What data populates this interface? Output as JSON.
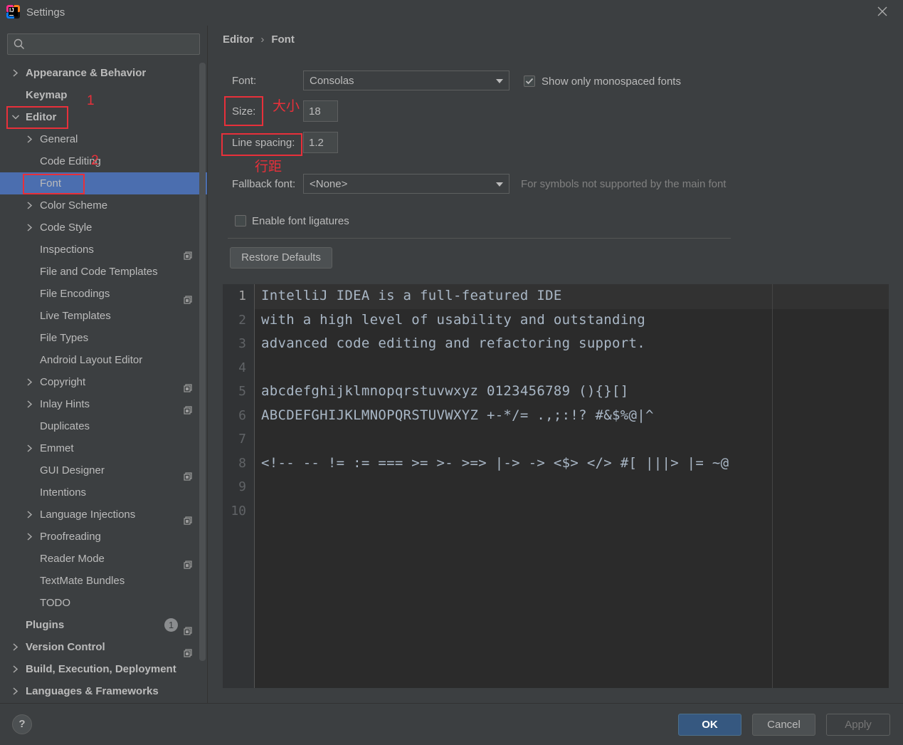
{
  "window": {
    "title": "Settings"
  },
  "search": {
    "placeholder": ""
  },
  "sidebar": {
    "items": [
      {
        "label": "Appearance & Behavior",
        "level": 0,
        "bold": true,
        "expandable": true,
        "expanded": false,
        "project_icon": false
      },
      {
        "label": "Keymap",
        "level": 0,
        "bold": true,
        "expandable": false,
        "project_icon": false
      },
      {
        "label": "Editor",
        "level": 0,
        "bold": true,
        "expandable": true,
        "expanded": true,
        "project_icon": false
      },
      {
        "label": "General",
        "level": 1,
        "expandable": true,
        "expanded": false,
        "project_icon": false
      },
      {
        "label": "Code Editing",
        "level": 1,
        "expandable": false,
        "project_icon": false
      },
      {
        "label": "Font",
        "level": 1,
        "expandable": false,
        "selected": true,
        "project_icon": false
      },
      {
        "label": "Color Scheme",
        "level": 1,
        "expandable": true,
        "expanded": false,
        "project_icon": false
      },
      {
        "label": "Code Style",
        "level": 1,
        "expandable": true,
        "expanded": false,
        "project_icon": false
      },
      {
        "label": "Inspections",
        "level": 1,
        "expandable": false,
        "project_icon": true
      },
      {
        "label": "File and Code Templates",
        "level": 1,
        "expandable": false,
        "project_icon": false
      },
      {
        "label": "File Encodings",
        "level": 1,
        "expandable": false,
        "project_icon": true
      },
      {
        "label": "Live Templates",
        "level": 1,
        "expandable": false,
        "project_icon": false
      },
      {
        "label": "File Types",
        "level": 1,
        "expandable": false,
        "project_icon": false
      },
      {
        "label": "Android Layout Editor",
        "level": 1,
        "expandable": false,
        "project_icon": false
      },
      {
        "label": "Copyright",
        "level": 1,
        "expandable": true,
        "expanded": false,
        "project_icon": true
      },
      {
        "label": "Inlay Hints",
        "level": 1,
        "expandable": true,
        "expanded": false,
        "project_icon": true
      },
      {
        "label": "Duplicates",
        "level": 1,
        "expandable": false,
        "project_icon": false
      },
      {
        "label": "Emmet",
        "level": 1,
        "expandable": true,
        "expanded": false,
        "project_icon": false
      },
      {
        "label": "GUI Designer",
        "level": 1,
        "expandable": false,
        "project_icon": true
      },
      {
        "label": "Intentions",
        "level": 1,
        "expandable": false,
        "project_icon": false
      },
      {
        "label": "Language Injections",
        "level": 1,
        "expandable": true,
        "expanded": false,
        "project_icon": true
      },
      {
        "label": "Proofreading",
        "level": 1,
        "expandable": true,
        "expanded": false,
        "project_icon": false
      },
      {
        "label": "Reader Mode",
        "level": 1,
        "expandable": false,
        "project_icon": true
      },
      {
        "label": "TextMate Bundles",
        "level": 1,
        "expandable": false,
        "project_icon": false
      },
      {
        "label": "TODO",
        "level": 1,
        "expandable": false,
        "project_icon": false
      },
      {
        "label": "Plugins",
        "level": 0,
        "bold": true,
        "expandable": false,
        "badge": "1",
        "project_icon": true
      },
      {
        "label": "Version Control",
        "level": 0,
        "bold": true,
        "expandable": true,
        "expanded": false,
        "project_icon": true
      },
      {
        "label": "Build, Execution, Deployment",
        "level": 0,
        "bold": true,
        "expandable": true,
        "expanded": false,
        "project_icon": false
      },
      {
        "label": "Languages & Frameworks",
        "level": 0,
        "bold": true,
        "expandable": true,
        "expanded": false,
        "project_icon": false
      }
    ],
    "plugins_badge": "1"
  },
  "breadcrumb": {
    "parent": "Editor",
    "separator": "›",
    "current": "Font"
  },
  "font_settings": {
    "font_label": "Font:",
    "font_value": "Consolas",
    "monospaced_label": "Show only monospaced fonts",
    "monospaced_checked": true,
    "size_label": "Size:",
    "size_value": "18",
    "line_spacing_label": "Line spacing:",
    "line_spacing_value": "1.2",
    "fallback_label": "Fallback font:",
    "fallback_value": "<None>",
    "fallback_hint": "For symbols not supported by the main font",
    "ligatures_label": "Enable font ligatures",
    "ligatures_checked": false,
    "restore_label": "Restore Defaults"
  },
  "preview": {
    "lines": [
      {
        "no": "1",
        "text": "IntelliJ IDEA is a full-featured IDE"
      },
      {
        "no": "2",
        "text": "with a high level of usability and outstanding"
      },
      {
        "no": "3",
        "text": "advanced code editing and refactoring support."
      },
      {
        "no": "4",
        "text": ""
      },
      {
        "no": "5",
        "text": "abcdefghijklmnopqrstuvwxyz 0123456789 (){}[]"
      },
      {
        "no": "6",
        "text": "ABCDEFGHIJKLMNOPQRSTUVWXYZ +-*/= .,;:!? #&$%@|^"
      },
      {
        "no": "7",
        "text": ""
      },
      {
        "no": "8",
        "text": "<!-- -- != := === >= >- >=> |-> -> <$> </> #[ |||> |= ~@"
      },
      {
        "no": "9",
        "text": ""
      },
      {
        "no": "10",
        "text": ""
      }
    ]
  },
  "annotations": {
    "marker_1": "1",
    "marker_2": "2",
    "size_note": "大小",
    "line_spacing_note": "行距",
    "color": "#e8303a"
  },
  "footer": {
    "help_label": "?",
    "ok_label": "OK",
    "cancel_label": "Cancel",
    "apply_label": "Apply"
  },
  "colors": {
    "background": "#3c3f41",
    "selection": "#4b6eaf",
    "editor_bg": "#2b2b2b",
    "gutter_bg": "#313335",
    "primary_button": "#365880"
  }
}
